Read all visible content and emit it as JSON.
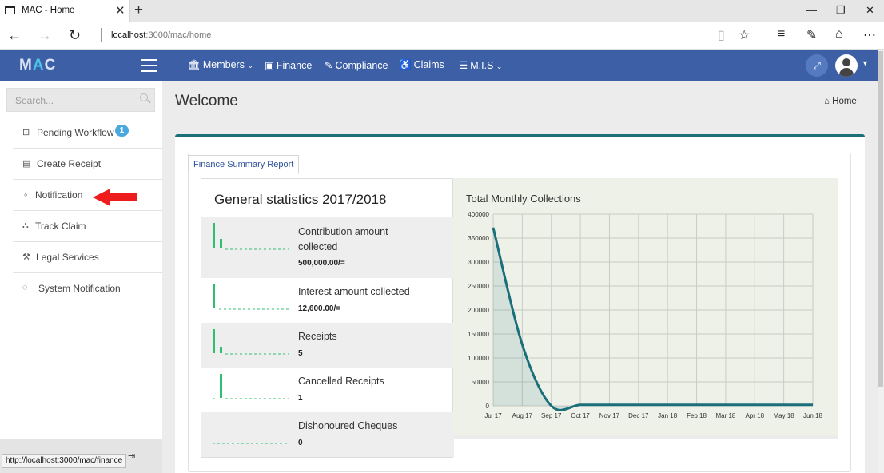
{
  "browser": {
    "tab_title": "MAC - Home",
    "url_host": "localhost",
    "url_path": ":3000/mac/home",
    "status_url": "http://localhost:3000/mac/finance"
  },
  "app": {
    "logo_m": "M",
    "logo_a": "A",
    "logo_c": "C",
    "nav": [
      {
        "label": "Members",
        "icon": "bank-icon",
        "has_dropdown": true
      },
      {
        "label": "Finance",
        "icon": "money-icon",
        "has_dropdown": false
      },
      {
        "label": "Compliance",
        "icon": "edit-icon",
        "has_dropdown": false
      },
      {
        "label": "Claims",
        "icon": "wheelchair-icon",
        "has_dropdown": false
      },
      {
        "label": "M.I.S",
        "icon": "list-icon",
        "has_dropdown": true
      }
    ],
    "brand_color": "#3c5fa6"
  },
  "sidebar": {
    "search_placeholder": "Search...",
    "items": [
      {
        "label": "Pending Workflow",
        "icon": "inbox-icon",
        "badge": "1"
      },
      {
        "label": "Create Receipt",
        "icon": "receipt-icon"
      },
      {
        "label": "Notification",
        "icon": "bell-icon"
      },
      {
        "label": "Track Claim",
        "icon": "track-icon"
      },
      {
        "label": "Legal Services",
        "icon": "gavel-icon"
      },
      {
        "label": "System Notification",
        "icon": "chat-icon"
      }
    ]
  },
  "page": {
    "title": "Welcome",
    "breadcrumb": "Home",
    "report_tab": "Finance Summary Report"
  },
  "stats": {
    "title": "General statistics 2017/2018",
    "rows": [
      {
        "label_line1": "Contribution amount",
        "label_line2": "collected",
        "value": "500,000.00/="
      },
      {
        "label_line1": "Interest amount collected",
        "label_line2": "",
        "value": "12,600.00/="
      },
      {
        "label_line1": "Receipts",
        "label_line2": "",
        "value": "5"
      },
      {
        "label_line1": "Cancelled Receipts",
        "label_line2": "",
        "value": "1"
      },
      {
        "label_line1": "Dishonoured Cheques",
        "label_line2": "",
        "value": "0"
      }
    ],
    "accent_color": "#2fbf71"
  },
  "chart_data": {
    "type": "line",
    "title": "Total Monthly Collections",
    "categories": [
      "Jul 17",
      "Aug 17",
      "Sep 17",
      "Oct 17",
      "Nov 17",
      "Dec 17",
      "Jan 18",
      "Feb 18",
      "Mar 18",
      "Apr 18",
      "May 18",
      "Jun 18"
    ],
    "values": [
      372000,
      128000,
      0,
      2000,
      2000,
      2000,
      2000,
      2000,
      2000,
      2000,
      2000,
      2000
    ],
    "ylim": [
      0,
      400000
    ],
    "yticks": [
      0,
      50000,
      100000,
      150000,
      200000,
      250000,
      300000,
      350000,
      400000
    ],
    "grid": true,
    "line_color": "#1a6f7a"
  }
}
